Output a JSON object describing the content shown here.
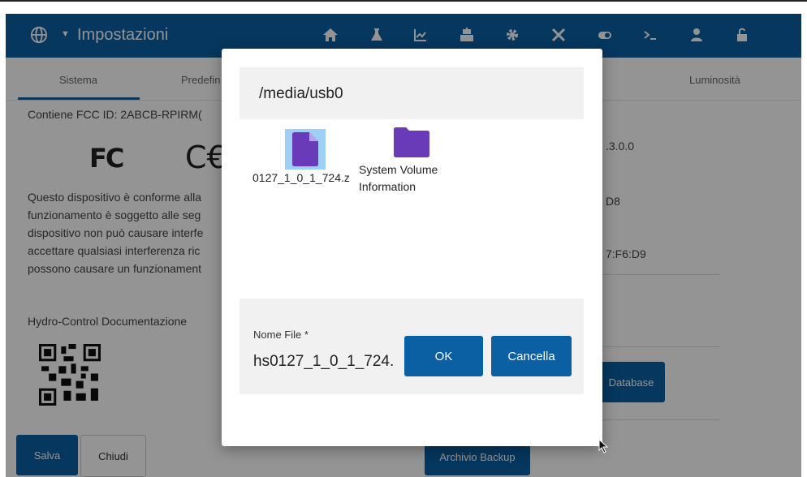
{
  "header": {
    "title": "Impostazioni",
    "globe_icon": "globe-icon",
    "icons": [
      "home-icon",
      "flask-icon",
      "chart-icon",
      "robot-icon",
      "gear-icon",
      "tools-icon",
      "toggle-icon",
      "terminal-icon",
      "user-icon",
      "unlock-icon"
    ],
    "color": "#0b5fa3"
  },
  "tabs": [
    {
      "label": "Sistema"
    },
    {
      "label": "Predefin"
    },
    {
      "label": "Luminosità"
    }
  ],
  "background": {
    "fcc_line": "Contiene FCC ID: 2ABCB-RPIRM(",
    "fcc_logo": "FC",
    "ce_logo": "C€",
    "compliance_lines": [
      "Questo dispositivo è conforme alla",
      "funzionamento è soggetto alle seg",
      "dispositivo non può causare interfe",
      "accettare qualsiasi interferenza ric",
      "possono causare un funzionament"
    ],
    "doc_title": "Hydro-Control Documentazione",
    "right_values": [
      ".3.0.0",
      "D8",
      "7:F6:D9"
    ],
    "database_button": "Database",
    "backup_button": "Archivio Backup",
    "save_button": "Salva",
    "close_button": "Chiudi"
  },
  "dialog": {
    "path": "/media/usb0",
    "files": [
      {
        "name": "0127_1_0_1_724.z",
        "type": "file",
        "icon": "file-icon",
        "selected": true
      },
      {
        "name": "System Volume Information",
        "type": "folder",
        "icon": "folder-icon"
      }
    ],
    "filename_label": "Nome File *",
    "filename_value": "hs0127_1_0_1_724.",
    "ok_label": "OK",
    "cancel_label": "Cancella",
    "accent_color": "#6a3bb8"
  }
}
